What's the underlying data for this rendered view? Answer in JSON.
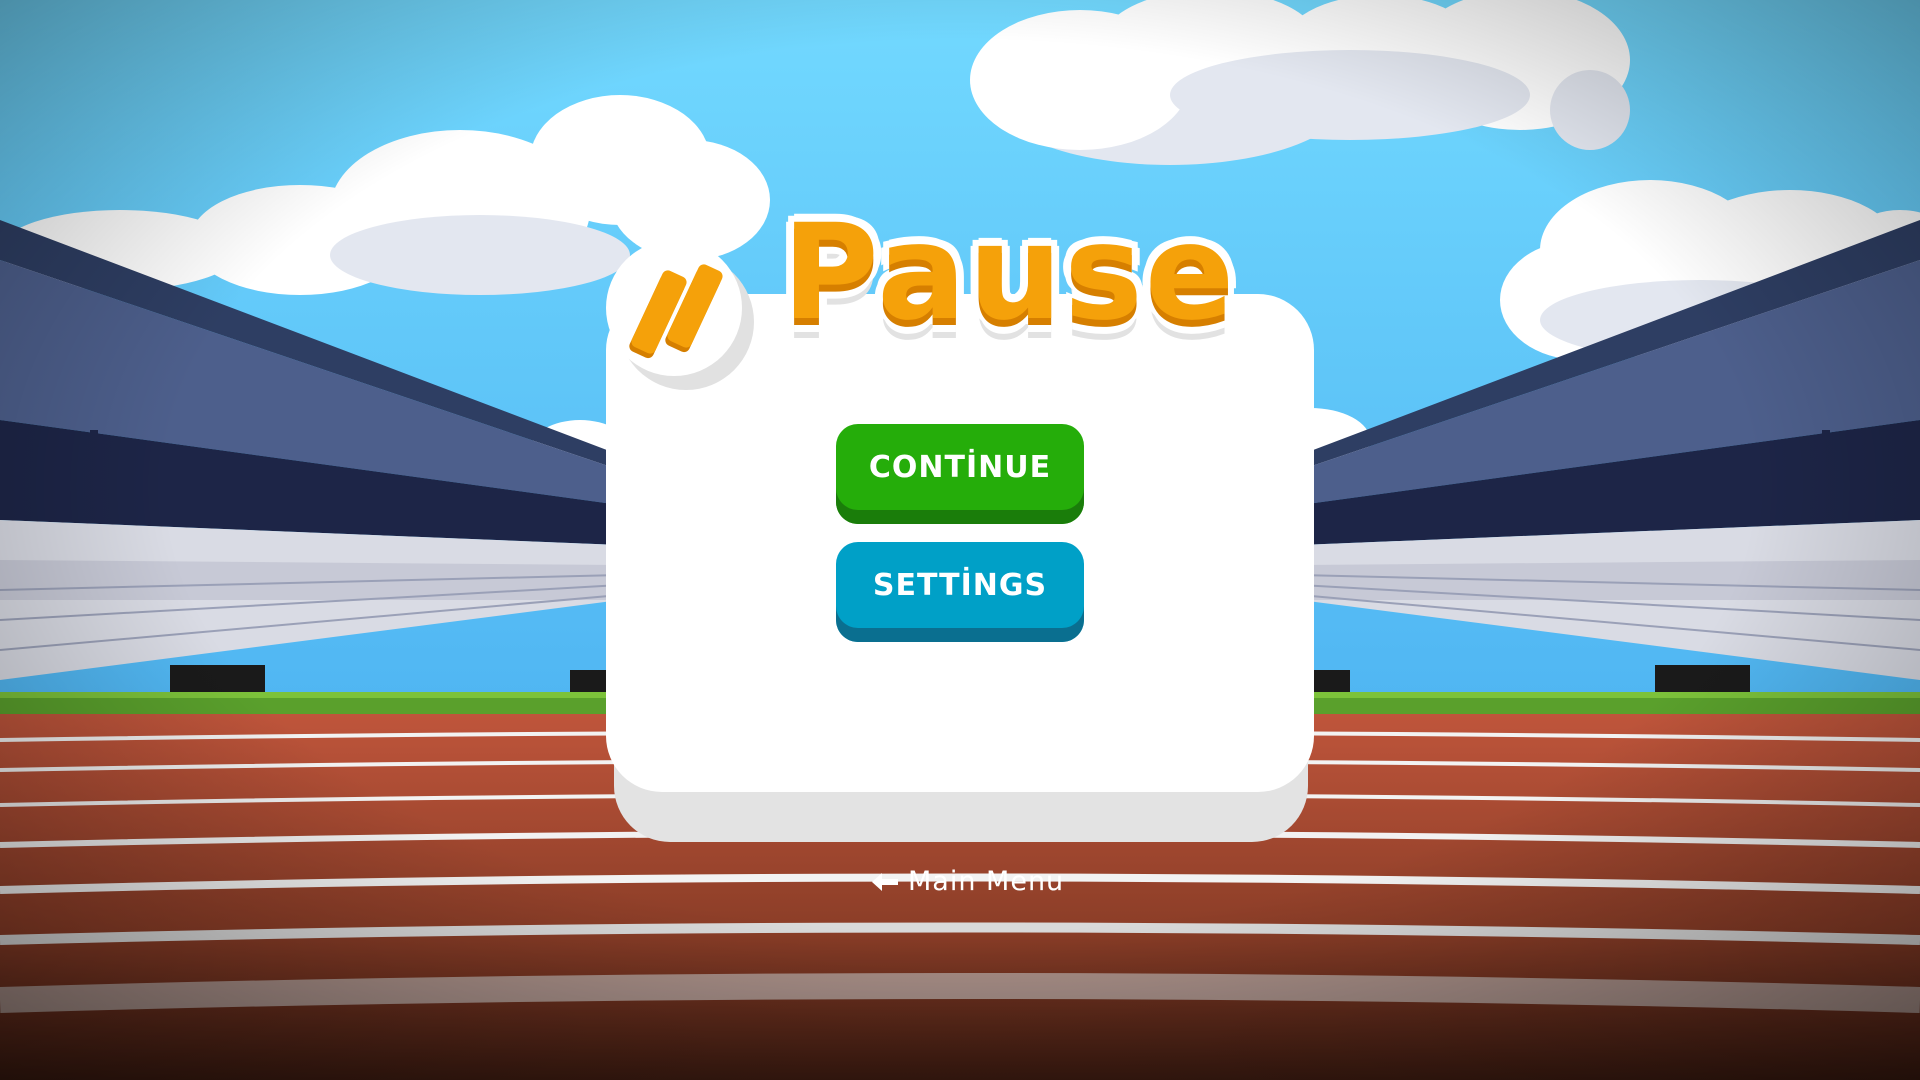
{
  "pause_panel": {
    "title": "Pause",
    "icon": "pause-icon",
    "buttons": {
      "continue_label": "CONTİNUE",
      "settings_label": "SETTİNGS"
    }
  },
  "footer": {
    "main_menu_label": "Main Menu",
    "main_menu_icon": "arrow-left-icon"
  },
  "colors": {
    "title": "#f5a10a",
    "continue": "#25ad0a",
    "settings": "#00a0c7",
    "sky_top": "#72d9ff",
    "sky_bottom": "#4fb5f2",
    "track": "#b6513a"
  }
}
